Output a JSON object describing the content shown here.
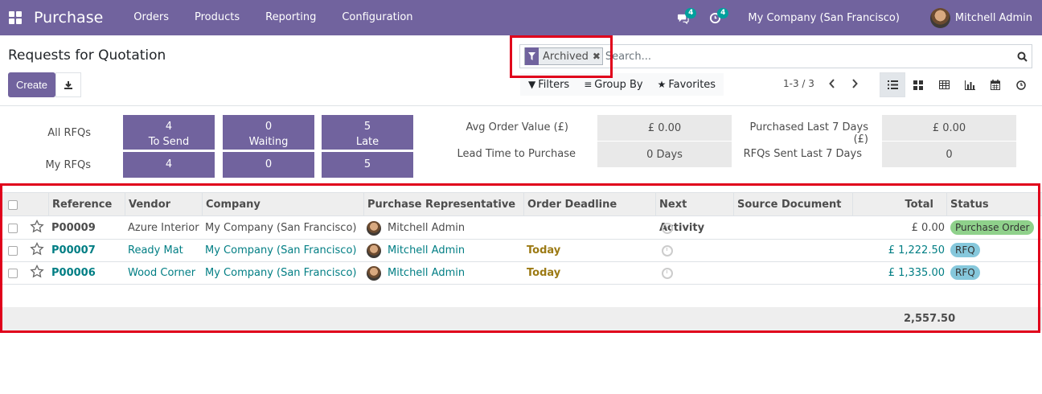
{
  "navbar": {
    "app_name": "Purchase",
    "menu": [
      "Orders",
      "Products",
      "Reporting",
      "Configuration"
    ],
    "messages_count": "4",
    "activities_count": "4",
    "company": "My Company (San Francisco)",
    "user": "Mitchell Admin",
    "color": "#71639e"
  },
  "control_panel": {
    "title": "Requests for Quotation",
    "create_label": "Create",
    "search": {
      "facet_label": "Archived",
      "placeholder": "Search..."
    },
    "filters_label": "Filters",
    "group_by_label": "Group By",
    "favorites_label": "Favorites",
    "pager": "1-3 / 3",
    "views": [
      "list-view-icon",
      "kanban-view-icon",
      "pivot-view-icon",
      "graph-view-icon",
      "calendar-view-icon",
      "activity-view-icon"
    ]
  },
  "dashboard": {
    "all_rfqs_label": "All RFQs",
    "my_rfqs_label": "My RFQs",
    "tiles": [
      {
        "count": "4",
        "label": "To Send",
        "my_count": "4"
      },
      {
        "count": "0",
        "label": "Waiting",
        "my_count": "0"
      },
      {
        "count": "5",
        "label": "Late",
        "my_count": "5"
      }
    ],
    "stats": [
      {
        "label": "Avg Order Value (£)",
        "value": "£ 0.00"
      },
      {
        "label": "Lead Time to Purchase",
        "value": "0  Days"
      },
      {
        "label": "Purchased Last 7 Days (£)",
        "value": "£ 0.00"
      },
      {
        "label": "RFQs Sent Last 7 Days",
        "value": "0"
      }
    ]
  },
  "table": {
    "columns": [
      "Reference",
      "Vendor",
      "Company",
      "Purchase Representative",
      "Order Deadline",
      "Next Activity",
      "Source Document",
      "Total",
      "Status"
    ],
    "rows": [
      {
        "reference": "P00009",
        "vendor": "Azure Interior",
        "company": "My Company (San Francisco)",
        "rep": "Mitchell Admin",
        "deadline": "",
        "source": "",
        "total": "£ 0.00",
        "status": "Purchase Order",
        "status_color": "#8fd18b",
        "link": false
      },
      {
        "reference": "P00007",
        "vendor": "Ready Mat",
        "company": "My Company (San Francisco)",
        "rep": "Mitchell Admin",
        "deadline": "Today",
        "source": "",
        "total": "£ 1,222.50",
        "status": "RFQ",
        "status_color": "#86c8dc",
        "link": true
      },
      {
        "reference": "P00006",
        "vendor": "Wood Corner",
        "company": "My Company (San Francisco)",
        "rep": "Mitchell Admin",
        "deadline": "Today",
        "source": "",
        "total": "£ 1,335.00",
        "status": "RFQ",
        "status_color": "#86c8dc",
        "link": true
      }
    ],
    "footer_total": "2,557.50"
  }
}
